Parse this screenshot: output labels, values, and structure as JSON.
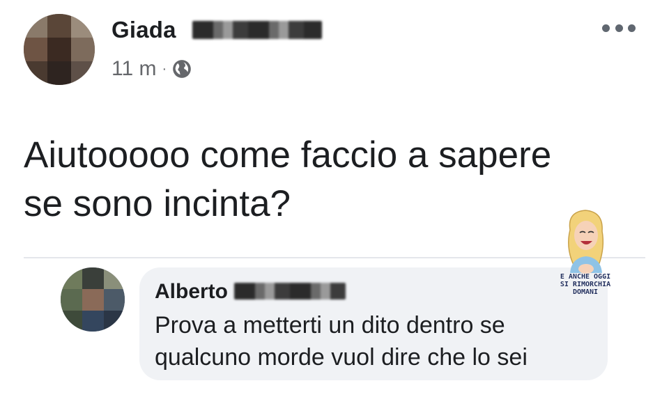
{
  "post": {
    "author_name": "Giada",
    "timestamp": "11 m",
    "separator": "·",
    "audience_icon": "globe-icon",
    "more_icon": "more-options-icon",
    "text": "Aiutooooo come faccio a sapere se sono incinta?"
  },
  "comment": {
    "author_name": "Alberto",
    "text": "Prova a metterti un dito dentro se qualcuno morde vuol dire che lo sei"
  },
  "watermark": {
    "line1": "E ANCHE OGGI",
    "line2": "SI RIMORCHIA DOMANI"
  },
  "colors": {
    "text": "#1c1e21",
    "meta": "#65676b",
    "bubble": "#f0f2f5",
    "divider": "#e4e6eb"
  }
}
